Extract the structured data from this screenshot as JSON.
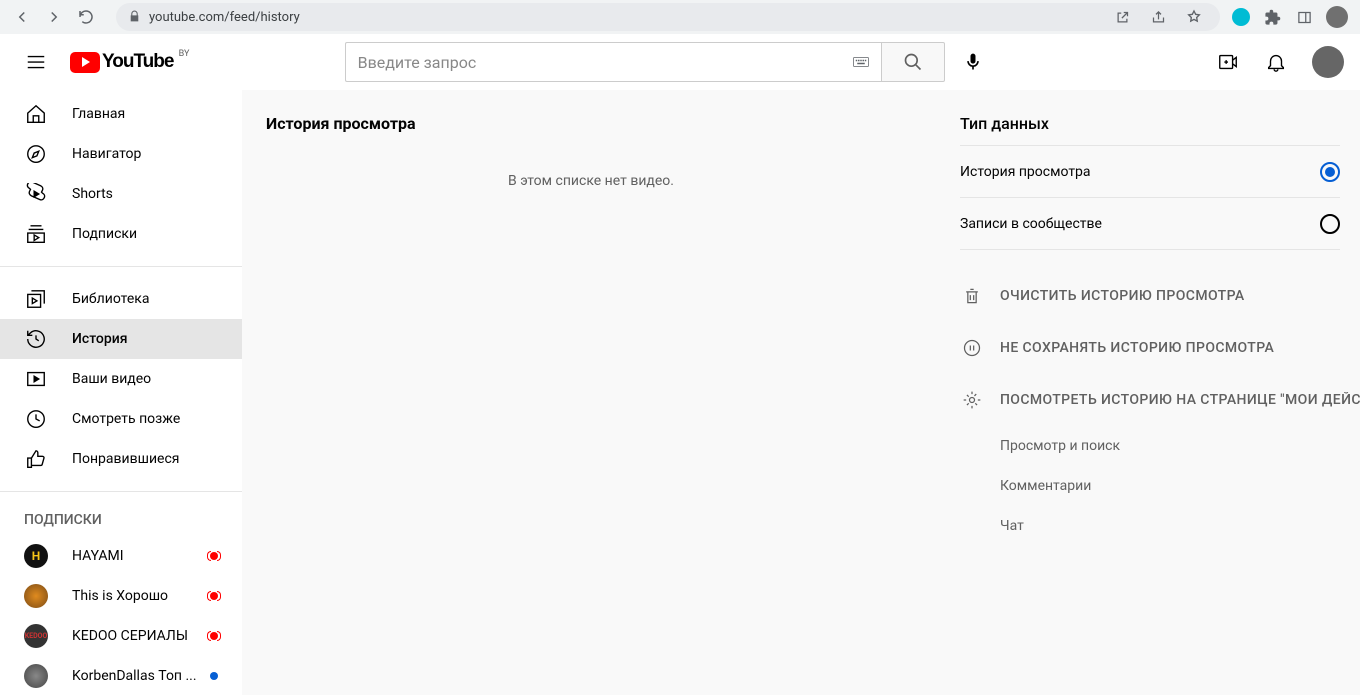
{
  "browser": {
    "url": "youtube.com/feed/history"
  },
  "logo": {
    "text": "YouTube",
    "country": "BY"
  },
  "search": {
    "placeholder": "Введите запрос"
  },
  "sidebar": {
    "section1": [
      {
        "icon": "home",
        "label": "Главная"
      },
      {
        "icon": "explore",
        "label": "Навигатор"
      },
      {
        "icon": "shorts",
        "label": "Shorts"
      },
      {
        "icon": "subs",
        "label": "Подписки"
      }
    ],
    "section2": [
      {
        "icon": "library",
        "label": "Библиотека"
      },
      {
        "icon": "history",
        "label": "История",
        "active": true
      },
      {
        "icon": "yourvids",
        "label": "Ваши видео"
      },
      {
        "icon": "later",
        "label": "Смотреть позже"
      },
      {
        "icon": "liked",
        "label": "Понравившиеся"
      }
    ],
    "subs_title": "ПОДПИСКИ",
    "channels": [
      {
        "label": "HAYAMI",
        "color": "#111",
        "inner": "#f5c518",
        "letter": "H",
        "live": true
      },
      {
        "label": "This is Хорошо",
        "color": "#7b4b16",
        "inner": "#e08b1f",
        "letter": "",
        "live": true
      },
      {
        "label": "KEDOO СЕРИАЛЫ",
        "color": "#8b2020",
        "inner": "#333",
        "letter": "",
        "live": true
      },
      {
        "label": "KorbenDallas Топ ...",
        "color": "#555",
        "inner": "#777",
        "letter": "",
        "dot": true
      }
    ]
  },
  "content": {
    "title": "История просмотра",
    "empty": "В этом списке нет видео."
  },
  "rpanel": {
    "title": "Тип данных",
    "radios": [
      {
        "label": "История просмотра",
        "checked": true
      },
      {
        "label": "Записи в сообществе",
        "checked": false
      }
    ],
    "actions": [
      {
        "icon": "trash",
        "label": "ОЧИСТИТЬ ИСТОРИЮ ПРОСМОТРА"
      },
      {
        "icon": "pause",
        "label": "НЕ СОХРАНЯТЬ ИСТОРИЮ ПРОСМОТРА"
      },
      {
        "icon": "gear",
        "label": "ПОСМОТРЕТЬ ИСТОРИЮ НА СТРАНИЦЕ \"МОИ ДЕЙС"
      }
    ],
    "links": [
      {
        "label": "Просмотр и поиск"
      },
      {
        "label": "Комментарии"
      },
      {
        "label": "Чат"
      }
    ]
  }
}
